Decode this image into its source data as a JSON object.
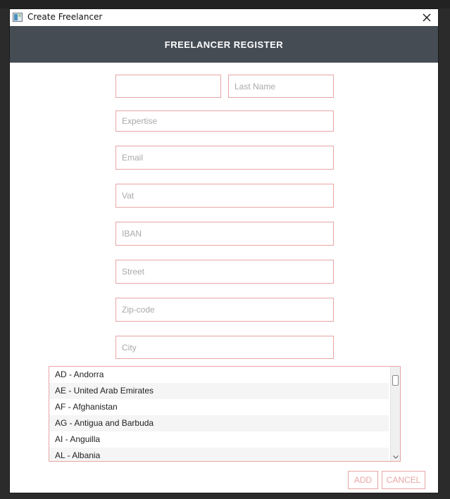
{
  "window": {
    "title": "Create Freelancer"
  },
  "header": {
    "title": "FREELANCER REGISTER"
  },
  "form": {
    "first_name": {
      "value": "",
      "placeholder": ""
    },
    "last_name": {
      "value": "",
      "placeholder": "Last Name"
    },
    "expertise": {
      "value": "",
      "placeholder": "Expertise"
    },
    "email": {
      "value": "",
      "placeholder": "Email"
    },
    "vat": {
      "value": "",
      "placeholder": "Vat"
    },
    "iban": {
      "value": "",
      "placeholder": "IBAN"
    },
    "street": {
      "value": "",
      "placeholder": "Street"
    },
    "zip": {
      "value": "",
      "placeholder": "Zip-code"
    },
    "city": {
      "value": "",
      "placeholder": "City"
    }
  },
  "countries": {
    "items": [
      "AD - Andorra",
      "AE - United Arab Emirates",
      "AF - Afghanistan",
      "AG - Antigua and Barbuda",
      "AI - Anguilla",
      "AL - Albania"
    ]
  },
  "actions": {
    "add_label": "ADD",
    "cancel_label": "CANCEL"
  },
  "colors": {
    "header_bg": "#454c54",
    "accent_border": "#e8a5a5",
    "placeholder_text": "#a9a9a9"
  },
  "icons": {
    "app": "app-window-icon",
    "close": "close-icon",
    "scroll_down": "chevron-down-icon"
  }
}
